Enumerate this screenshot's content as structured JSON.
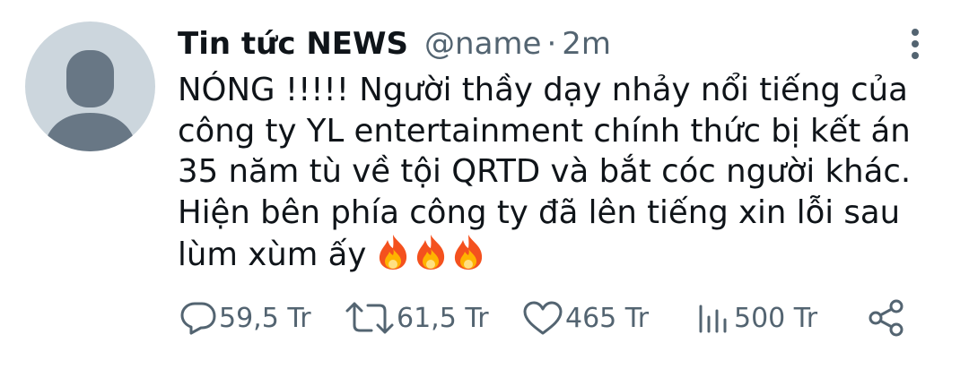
{
  "tweet": {
    "display_name": "Tin tức NEWS",
    "handle": "@name",
    "separator": "·",
    "time": "2m",
    "text": "NÓNG !!!!! Người thầy dạy nhảy nổi tiếng của\ncông ty YL entertainment chính thức bị kết án\n35 năm tù về tội QRTD và bắt cóc người khác.\nHiện bên phía công ty đã lên tiếng xin lỗi sau\nlùm xùm ấy",
    "emoji": [
      "fire-icon",
      "fire-icon",
      "fire-icon"
    ]
  },
  "actions": {
    "replies": "59,5 Tr",
    "retweets": "61,5 Tr",
    "likes": "465 Tr",
    "views": "500 Tr"
  },
  "colors": {
    "text": "#0f1419",
    "secondary": "#536471",
    "avatar_bg": "#ccd6dd",
    "avatar_fg": "#687785"
  }
}
